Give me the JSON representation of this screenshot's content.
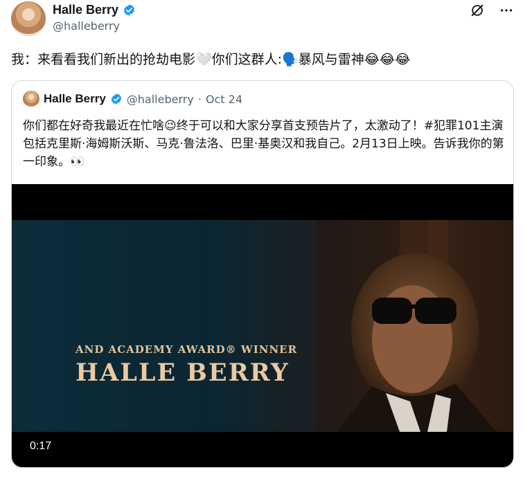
{
  "header": {
    "display_name": "Halle Berry",
    "handle": "@halleberry",
    "avatar_icon": "profile-avatar",
    "badge_icon": "verified-badge-icon",
    "badge_color": "#1d9bf0"
  },
  "tweet": {
    "text": "我：来看看我们新出的抢劫电影🤍你们这群人:🗣️暴风与雷神😂😂😂"
  },
  "quoted": {
    "display_name": "Halle Berry",
    "handle": "@halleberry",
    "separator": "·",
    "date": "Oct 24",
    "text": "你们都在好奇我最近在忙啥😉终于可以和大家分享首支预告片了，太激动了！#犯罪101主演包括克里斯·海姆斯沃斯、马克·鲁法洛、巴里·基奥汉和我自己。2月13日上映。告诉我你的第一印象。👀",
    "video": {
      "overlay_line1": "AND ACADEMY AWARD® WINNER",
      "overlay_line2": "HALLE BERRY",
      "timestamp": "0:17"
    }
  },
  "colors": {
    "text": "#0f1419",
    "muted": "#536471",
    "border": "#cfd9de",
    "accent": "#1d9bf0"
  }
}
